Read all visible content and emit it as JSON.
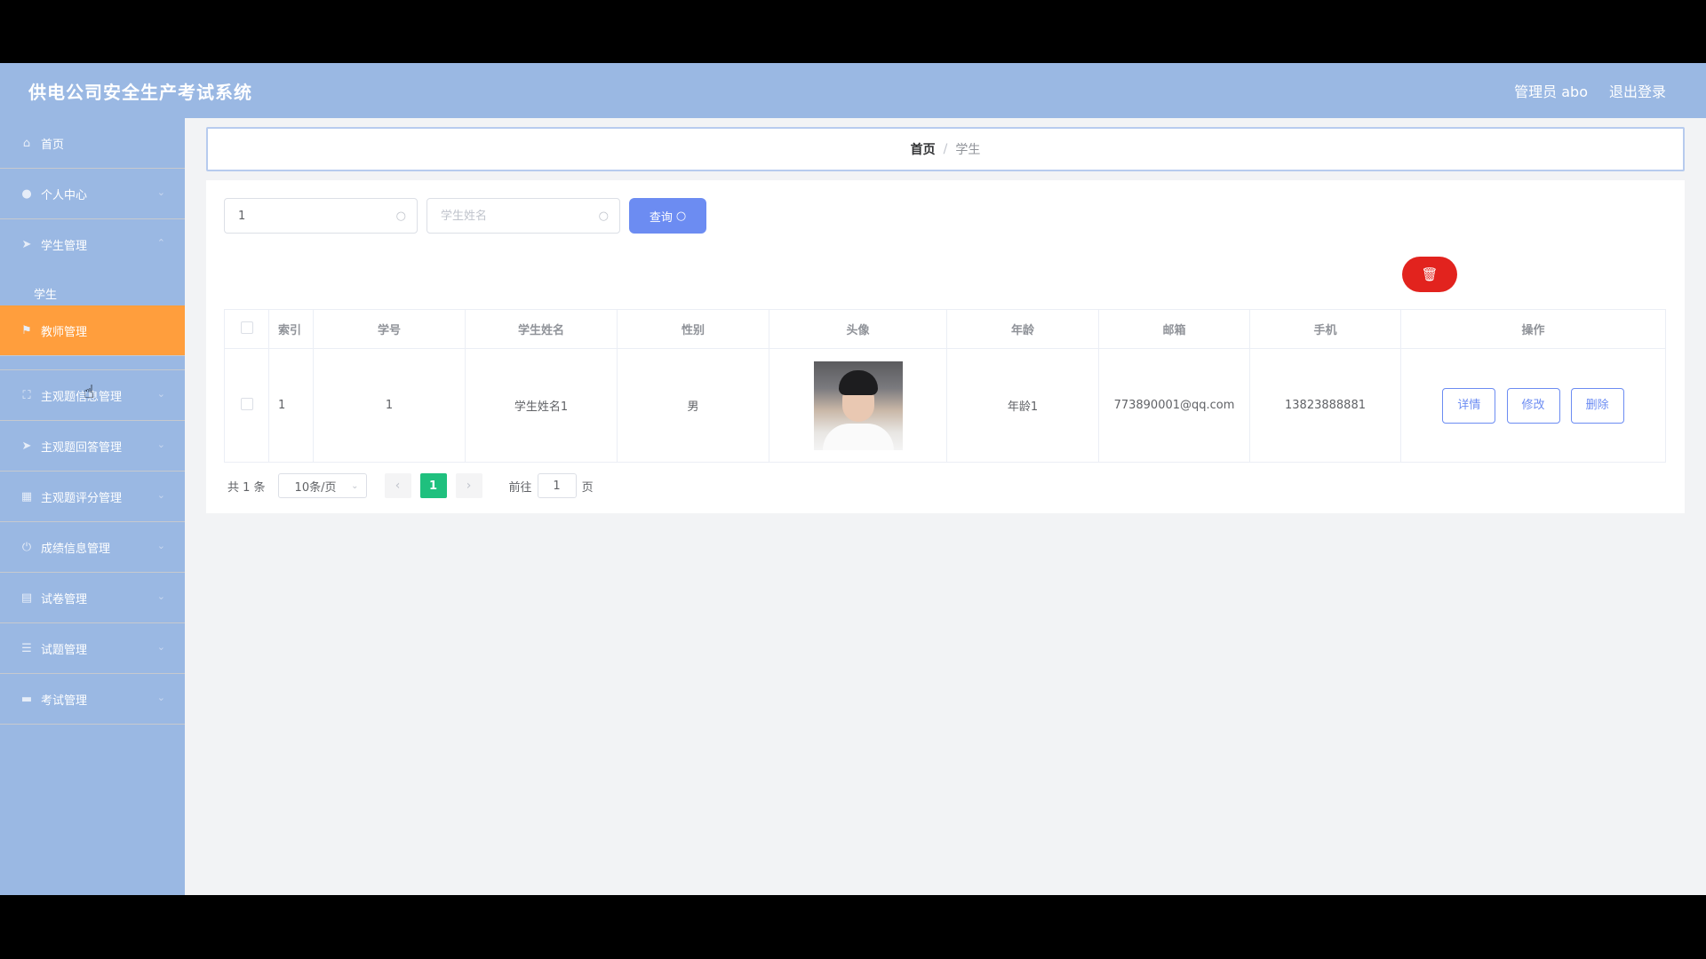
{
  "header": {
    "title": "供电公司安全生产考试系统",
    "user": "管理员 abo",
    "logout": "退出登录"
  },
  "sidebar": {
    "items": [
      {
        "label": "首页",
        "icon": "home-icon"
      },
      {
        "label": "个人中心",
        "icon": "user-icon"
      },
      {
        "label": "学生管理",
        "icon": "send-icon"
      },
      {
        "label": "教师管理",
        "icon": "flag-icon"
      },
      {
        "label": "主观题信息管理",
        "icon": "frame-icon"
      },
      {
        "label": "主观题回答管理",
        "icon": "send-icon"
      },
      {
        "label": "主观题评分管理",
        "icon": "grid-icon"
      },
      {
        "label": "成绩信息管理",
        "icon": "power-icon"
      },
      {
        "label": "试卷管理",
        "icon": "clipboard-icon"
      },
      {
        "label": "试题管理",
        "icon": "list-icon"
      },
      {
        "label": "考试管理",
        "icon": "briefcase-icon"
      }
    ],
    "submenu": {
      "label": "学生"
    }
  },
  "breadcrumb": {
    "home": "首页",
    "separator": "/",
    "current": "学生"
  },
  "search": {
    "field1_value": "1",
    "field2_placeholder": "学生姓名",
    "query_label": "查询"
  },
  "table": {
    "headers": [
      "索引",
      "学号",
      "学生姓名",
      "性别",
      "头像",
      "年龄",
      "邮箱",
      "手机",
      "操作"
    ],
    "rows": [
      {
        "index": "1",
        "student_id": "1",
        "name": "学生姓名1",
        "gender": "男",
        "age": "年龄1",
        "email": "773890001@qq.com",
        "phone": "13823888881"
      }
    ],
    "actions": {
      "detail": "详情",
      "edit": "修改",
      "delete": "删除"
    }
  },
  "pagination": {
    "total": "共 1 条",
    "page_size": "10条/页",
    "current_page": "1",
    "goto_prefix": "前往",
    "goto_value": "1",
    "goto_suffix": "页"
  },
  "colors": {
    "header_bg": "#9ab8e3",
    "active_menu": "#ff9e3d",
    "primary": "#6c8cf2",
    "danger": "#e2231e",
    "page_active": "#1fc07e"
  }
}
